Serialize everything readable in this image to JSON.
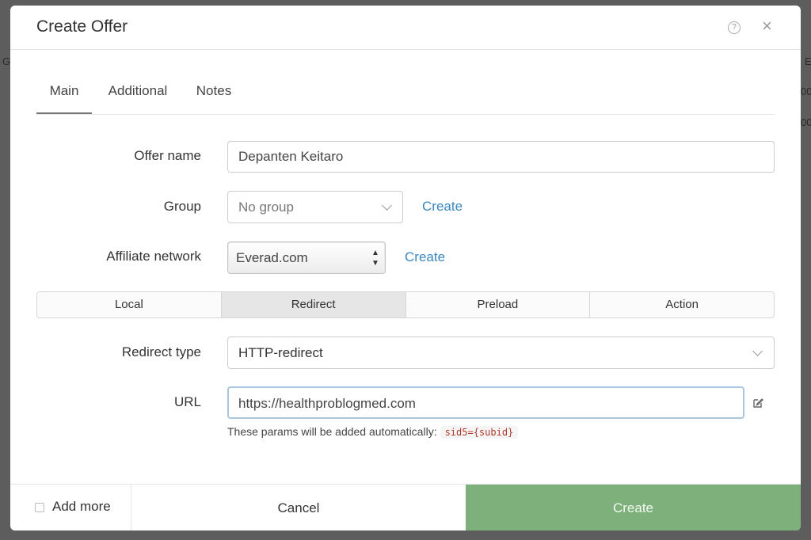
{
  "background": {
    "glyph_left": "G",
    "glyph_right": "E",
    "row_values": [
      "00",
      "00"
    ]
  },
  "modal": {
    "title": "Create Offer",
    "help_icon": "question-circle-icon",
    "close_icon": "close-icon",
    "close_glyph": "×",
    "help_glyph": "?"
  },
  "tabs": [
    {
      "label": "Main",
      "active": true
    },
    {
      "label": "Additional",
      "active": false
    },
    {
      "label": "Notes",
      "active": false
    }
  ],
  "form": {
    "offer_name": {
      "label": "Offer name",
      "value": "Depanten Keitaro"
    },
    "group": {
      "label": "Group",
      "value": "No group",
      "create_link": "Create"
    },
    "affiliate_network": {
      "label": "Affiliate network",
      "value": "Everad.com",
      "create_link": "Create"
    },
    "offer_type": {
      "options": [
        "Local",
        "Redirect",
        "Preload",
        "Action"
      ],
      "selected": "Redirect"
    },
    "redirect_type": {
      "label": "Redirect type",
      "value": "HTTP-redirect"
    },
    "url": {
      "label": "URL",
      "value": "https://healthproblogmed.com",
      "edit_icon": "edit-icon",
      "hint": "These params will be added automatically:",
      "params": "sid5={subid}"
    }
  },
  "footer": {
    "add_more_label": "Add more",
    "add_more_checked": false,
    "cancel_label": "Cancel",
    "create_label": "Create"
  },
  "colors": {
    "primary_button": "#7db07a",
    "link": "#3a86c0",
    "code_text": "#b03a2e"
  }
}
